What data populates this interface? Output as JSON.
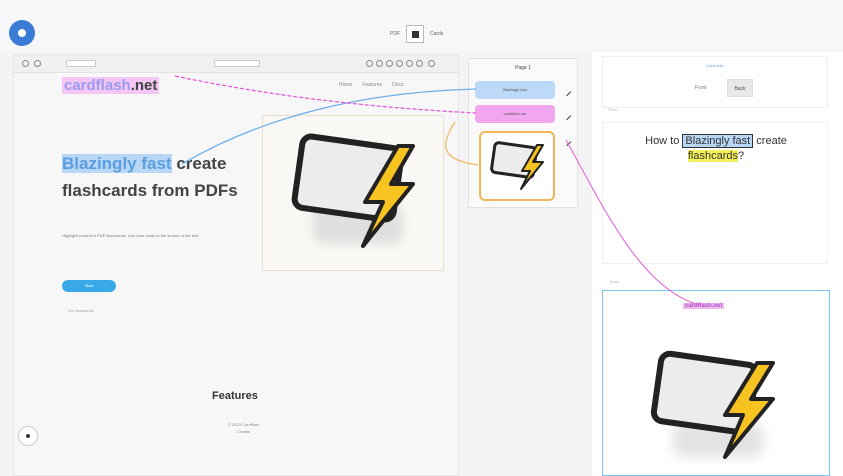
{
  "toolbar": {
    "mode_left": "PDF",
    "mode_right": "Cards"
  },
  "pdf": {
    "site_logo": "cardflash",
    "site_logo_suffix": ".net",
    "nav": [
      "Home",
      "Features",
      "Docs"
    ],
    "headline_highlight": "Blazingly fast",
    "headline_rest": " create flashcards from PDFs",
    "sub_text": "Highlight content in PDF documents. Link your cards to the source of the text.",
    "cta_label": "Start",
    "small_link": "Get flashcards",
    "features_title": "Features",
    "footer_line1": "© 2023 Cardflash",
    "footer_line2": "Credits"
  },
  "outline": {
    "page_label": "Page 1",
    "ref_blue": "Blazingly fast",
    "ref_pink": "cardflash.net"
  },
  "card": {
    "top_label": "Card side",
    "tab_front": "Front",
    "tab_back": "Back",
    "front_label": "Front",
    "question_prefix": "How to ",
    "question_highlight": "Blazingly fast",
    "question_mid": " create ",
    "question_yellow": "flashcards",
    "question_suffix": "?",
    "back_label": "Back",
    "answer_tag": "cardflash.net"
  },
  "colors": {
    "accent": "#3a7bd5",
    "highlight_blue": "#b8d6f5",
    "highlight_pink": "#f3a6f0",
    "highlight_yellow": "#f4f05a",
    "link_blue_line": "#6aaee8",
    "link_pink_line": "#e25cd8"
  }
}
